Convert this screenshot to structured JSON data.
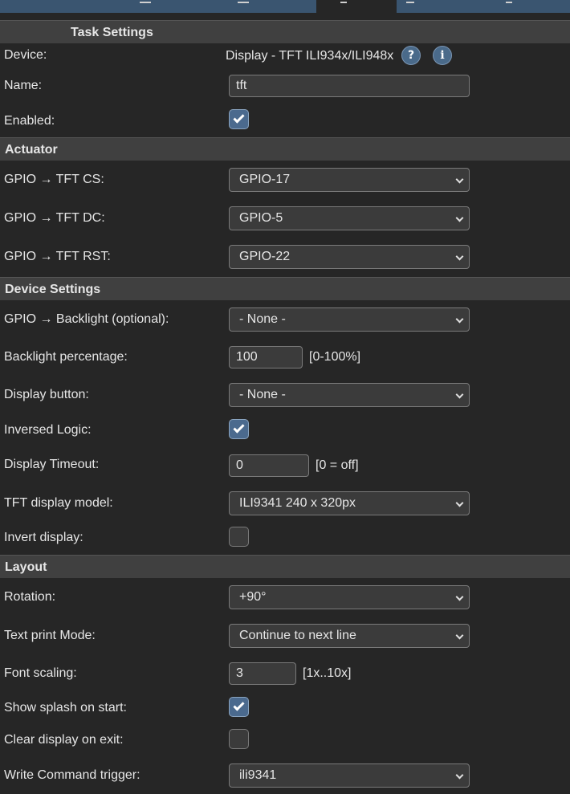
{
  "colors": {
    "background": "#262626",
    "section_header": "#404040",
    "tab": "#3a5570",
    "checkbox_checked": "#4b6a8e"
  },
  "task_settings": {
    "header": "Task Settings",
    "device_label": "Device:",
    "device_value": "Display - TFT ILI934x/ILI948x",
    "help_icon": "?",
    "info_icon": "i",
    "name_label": "Name:",
    "name_value": "tft",
    "enabled_label": "Enabled:",
    "enabled": true
  },
  "actuator": {
    "header": "Actuator",
    "cs_label": "GPIO → TFT CS:",
    "cs_value": "GPIO-17",
    "dc_label": "GPIO → TFT DC:",
    "dc_value": "GPIO-5",
    "rst_label": "GPIO → TFT RST:",
    "rst_value": "GPIO-22"
  },
  "device_settings": {
    "header": "Device Settings",
    "backlight_label": "GPIO → Backlight (optional):",
    "backlight_value": "- None -",
    "backlight_pct_label": "Backlight percentage:",
    "backlight_pct_value": "100",
    "backlight_pct_hint": "[0-100%]",
    "display_button_label": "Display button:",
    "display_button_value": "- None -",
    "inversed_logic_label": "Inversed Logic:",
    "inversed_logic": true,
    "display_timeout_label": "Display Timeout:",
    "display_timeout_value": "0",
    "display_timeout_hint": "[0 = off]",
    "model_label": "TFT display model:",
    "model_value": "ILI9341 240 x 320px",
    "invert_display_label": "Invert display:",
    "invert_display": false
  },
  "layout": {
    "header": "Layout",
    "rotation_label": "Rotation:",
    "rotation_value": "+90°",
    "text_print_label": "Text print Mode:",
    "text_print_value": "Continue to next line",
    "font_scaling_label": "Font scaling:",
    "font_scaling_value": "3",
    "font_scaling_hint": "[1x..10x]",
    "splash_label": "Show splash on start:",
    "splash": true,
    "clear_exit_label": "Clear display on exit:",
    "clear_exit": false,
    "write_cmd_label": "Write Command trigger:",
    "write_cmd_value": "ili9341"
  }
}
